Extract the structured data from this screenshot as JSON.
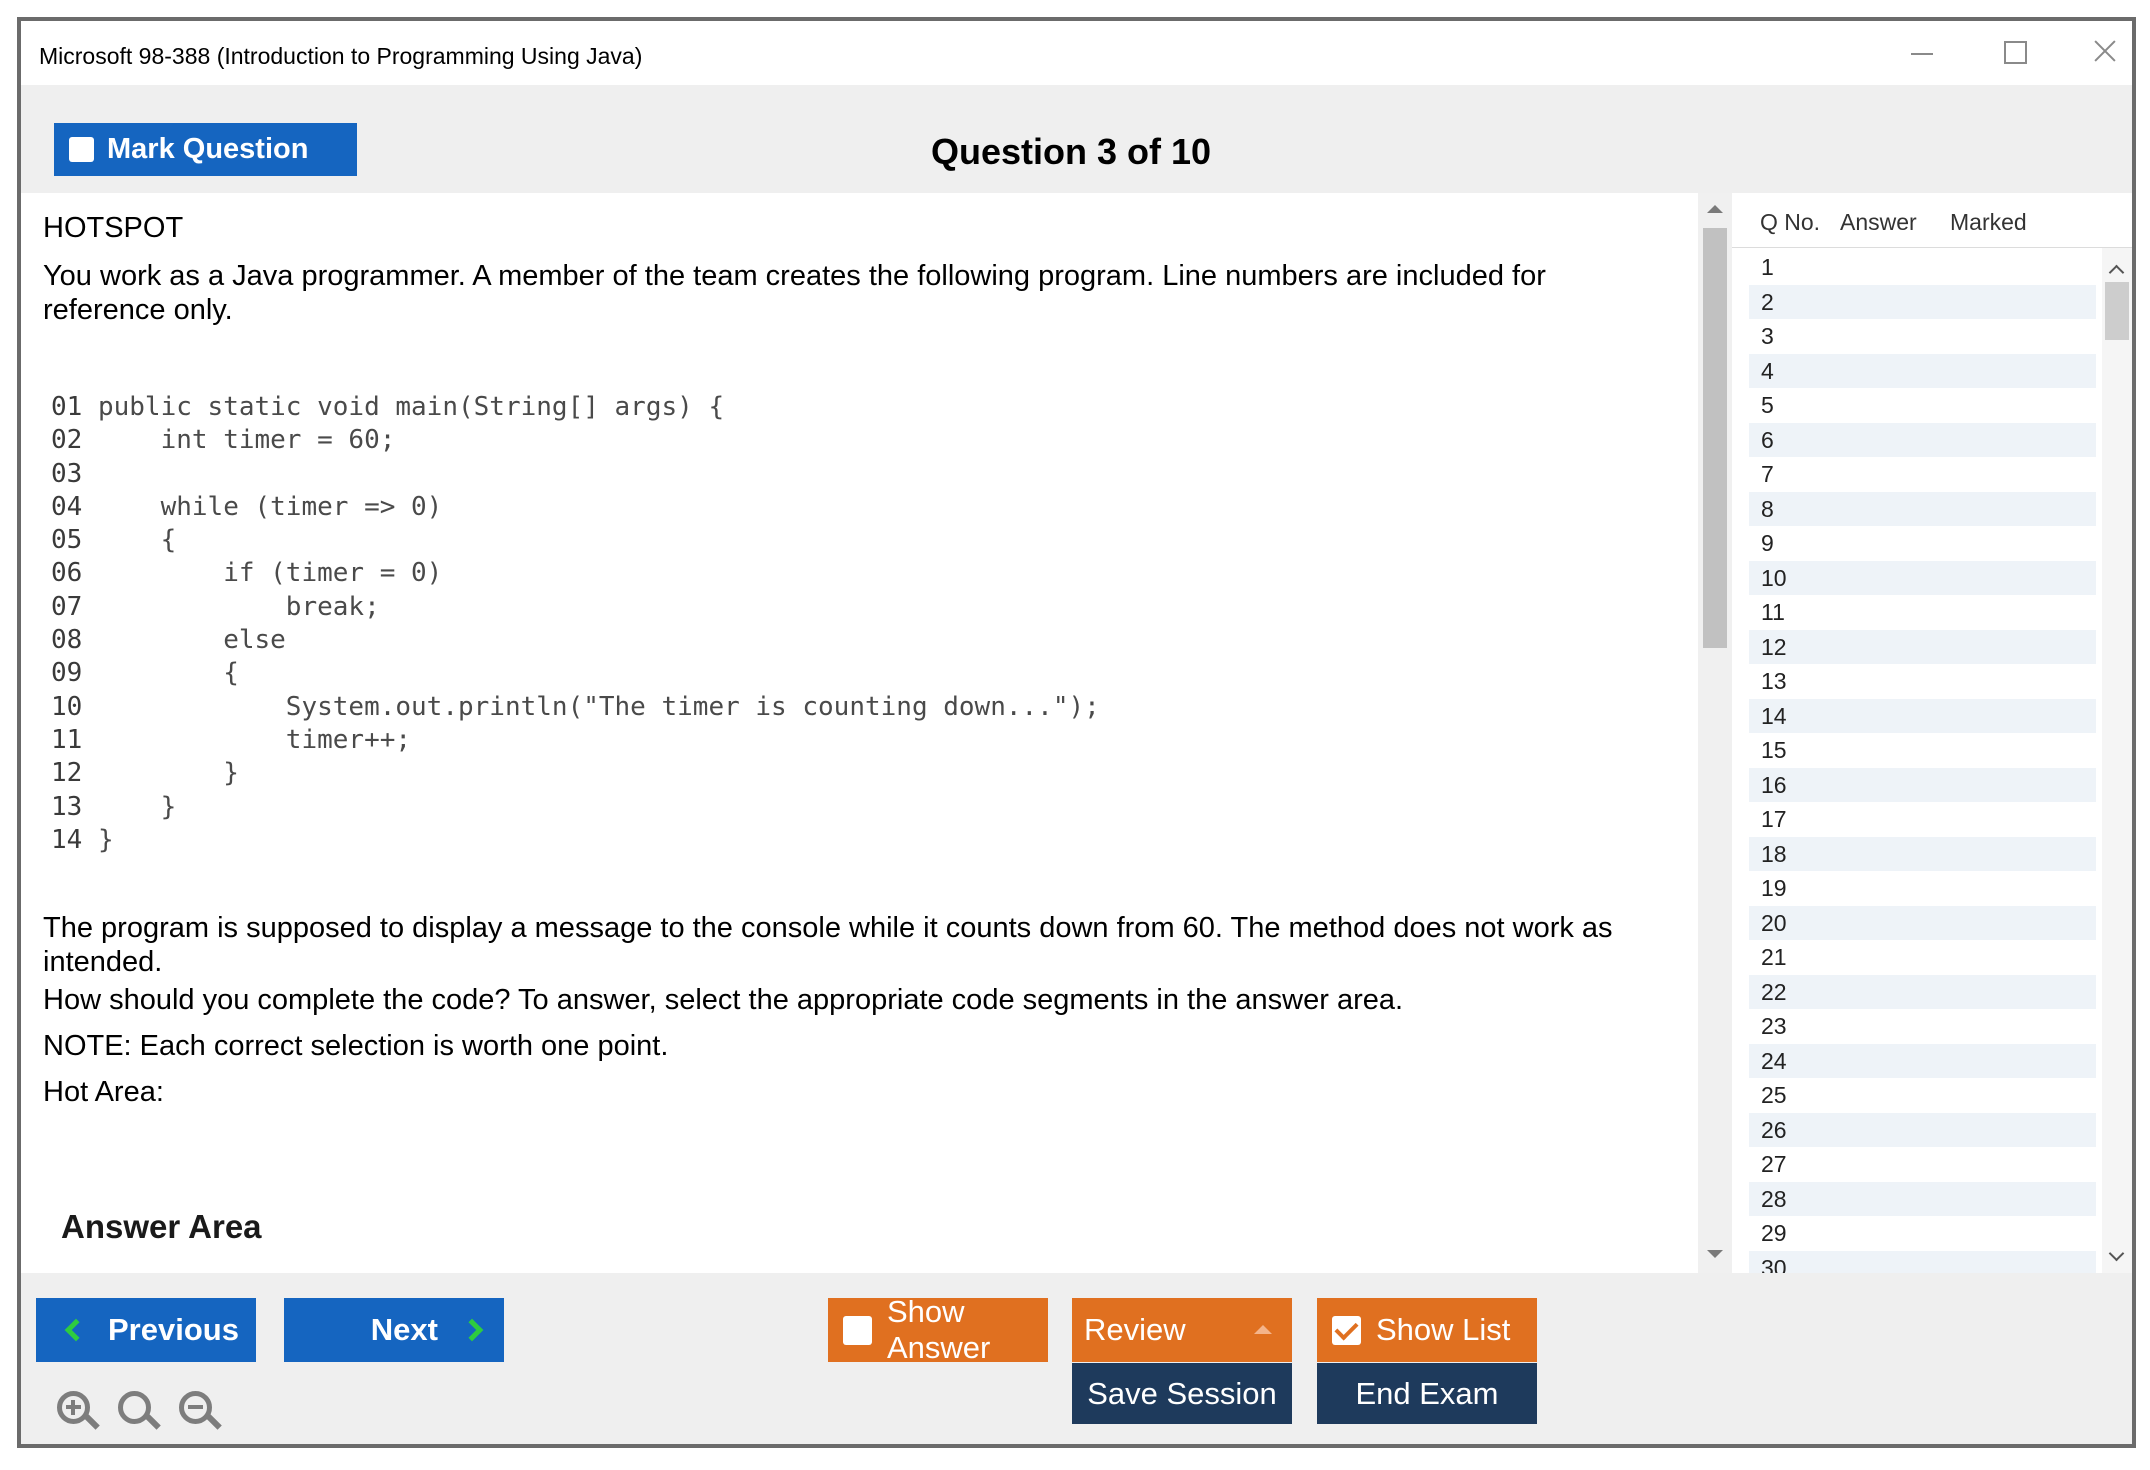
{
  "window": {
    "title": "Microsoft 98-388 (Introduction to Programming Using Java)"
  },
  "header": {
    "mark_question_label": "Mark Question",
    "question_counter": "Question 3 of 10"
  },
  "question": {
    "type": "HOTSPOT",
    "intro": "You work as a Java programmer. A member of the team creates the following program. Line numbers are included for reference only.",
    "code_lines": [
      {
        "num": "01",
        "text": " public static void main(String[] args) {"
      },
      {
        "num": "02",
        "text": "     int timer = 60;"
      },
      {
        "num": "03",
        "text": ""
      },
      {
        "num": "04",
        "text": "     while (timer => 0)"
      },
      {
        "num": "05",
        "text": "     {"
      },
      {
        "num": "06",
        "text": "         if (timer = 0)"
      },
      {
        "num": "07",
        "text": "             break;"
      },
      {
        "num": "08",
        "text": "         else"
      },
      {
        "num": "09",
        "text": "         {"
      },
      {
        "num": "10",
        "text": "             System.out.println(\"The timer is counting down...\");"
      },
      {
        "num": "11",
        "text": "             timer++;"
      },
      {
        "num": "12",
        "text": "         }"
      },
      {
        "num": "13",
        "text": "     }"
      },
      {
        "num": "14",
        "text": " }"
      }
    ],
    "description": "The program is supposed to display a message to the console while it counts down from 60. The method does not work as intended.",
    "instruction": "How should you complete the code? To answer, select the appropriate code segments in the answer area.",
    "note": "NOTE: Each correct selection is worth one point.",
    "hot_area_label": "Hot Area:",
    "answer_area_label": "Answer Area"
  },
  "question_list": {
    "columns": [
      "Q No.",
      "Answer",
      "Marked"
    ],
    "rows": [
      "1",
      "2",
      "3",
      "4",
      "5",
      "6",
      "7",
      "8",
      "9",
      "10",
      "11",
      "12",
      "13",
      "14",
      "15",
      "16",
      "17",
      "18",
      "19",
      "20",
      "21",
      "22",
      "23",
      "24",
      "25",
      "26",
      "27",
      "28",
      "29",
      "30"
    ]
  },
  "footer": {
    "previous_label": "Previous",
    "next_label": "Next",
    "show_answer_label": "Show Answer",
    "review_label": "Review",
    "show_list_label": "Show List",
    "save_session_label": "Save Session",
    "end_exam_label": "End Exam"
  },
  "colors": {
    "primary_blue": "#1565c0",
    "orange": "#e07020",
    "navy": "#1e3a5c",
    "chevron_green": "#2ecc40"
  },
  "icons": [
    "zoom-in-icon",
    "zoom-reset-icon",
    "zoom-out-icon"
  ]
}
